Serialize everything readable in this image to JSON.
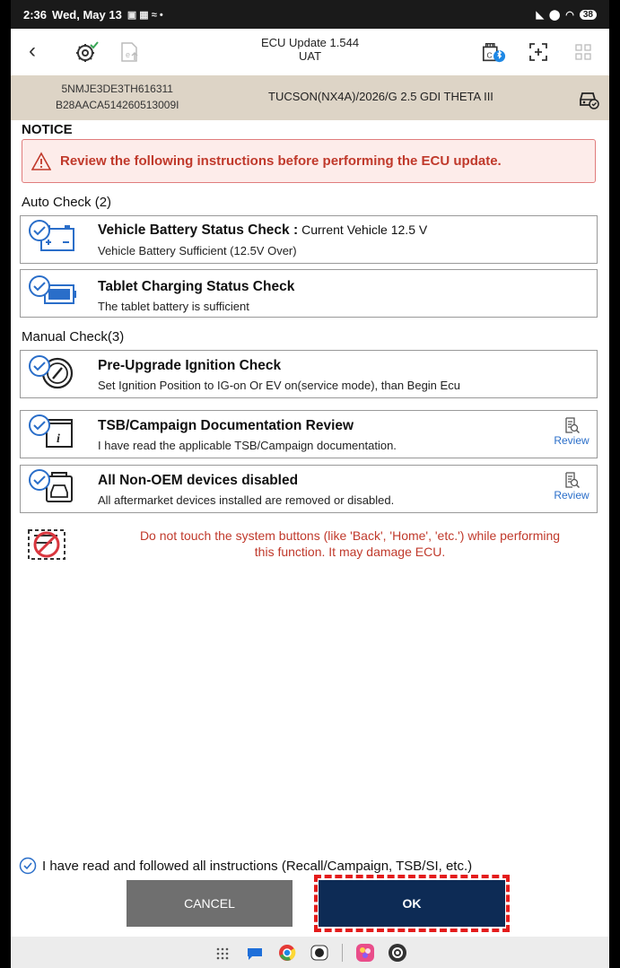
{
  "status_bar": {
    "time": "2:36",
    "date": "Wed, May 13",
    "battery": "38"
  },
  "header": {
    "title": "ECU Update 1.544",
    "subtitle": "UAT"
  },
  "vehicle": {
    "vin": "5NMJE3DE3TH616311",
    "ecu_id": "B28AACA514260513009I",
    "model": "TUCSON(NX4A)/2026/G 2.5 GDI THETA III"
  },
  "notice": {
    "heading": "NOTICE",
    "message": "Review the following instructions before performing the ECU update."
  },
  "auto_check": {
    "heading": "Auto Check (2)",
    "items": [
      {
        "title": "Vehicle Battery Status Check :",
        "extra": "Current Vehicle 12.5 V",
        "detail": "Vehicle Battery Sufficient (12.5V Over)"
      },
      {
        "title": "Tablet Charging Status Check",
        "detail": "The tablet battery is sufficient"
      }
    ]
  },
  "manual_check": {
    "heading": "Manual Check(3)",
    "items": [
      {
        "title": "Pre-Upgrade Ignition Check",
        "detail": "Set Ignition Position to IG-on Or EV on(service mode), than Begin Ecu"
      },
      {
        "title": "TSB/Campaign Documentation Review",
        "detail": "I have read the applicable TSB/Campaign documentation.",
        "action": "Review"
      },
      {
        "title": "All Non-OEM devices disabled",
        "detail": "All aftermarket devices installed are removed or disabled.",
        "action": "Review"
      }
    ]
  },
  "warning": {
    "text": "Do not touch the system buttons (like 'Back', 'Home', 'etc.') while performing this function. It may damage ECU."
  },
  "confirmation": {
    "text": "I have read and followed all instructions (Recall/Campaign, TSB/SI, etc.)",
    "checked": true
  },
  "buttons": {
    "cancel": "CANCEL",
    "ok": "OK"
  },
  "colors": {
    "accent": "#2a6ec9",
    "ok_button": "#0d2b55",
    "cancel_button": "#6f6f6f",
    "warning_red": "#c0392b",
    "vin_bar": "#ddd4c6",
    "highlight": "#e41b1b"
  }
}
